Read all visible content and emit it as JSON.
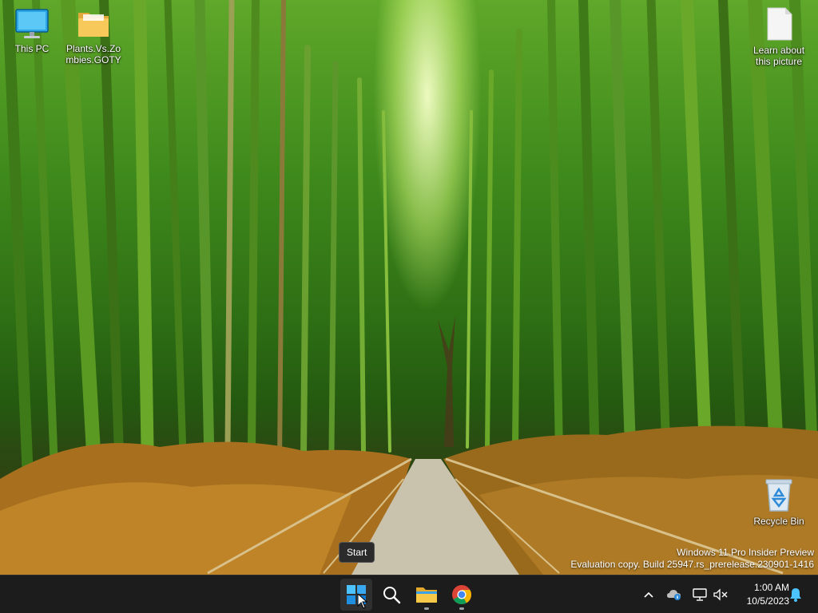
{
  "desktop": {
    "icons": [
      {
        "label": "This PC",
        "icon": "monitor-icon"
      },
      {
        "label": "Plants.Vs.Zombies.GOTY",
        "icon": "folder-icon"
      },
      {
        "label": "Learn about this picture",
        "icon": "file-icon"
      },
      {
        "label": "Recycle Bin",
        "icon": "recycle-bin-icon"
      }
    ]
  },
  "watermark": {
    "line1": "Windows 11 Pro Insider Preview",
    "line2": "Evaluation copy. Build 25947.rs_prerelease.230901-1416"
  },
  "tooltip": {
    "text": "Start"
  },
  "taskbar": {
    "apps": [
      {
        "name": "Start",
        "icon": "windows-start-icon"
      },
      {
        "name": "Search",
        "icon": "search-icon"
      },
      {
        "name": "File Explorer",
        "icon": "file-explorer-icon"
      },
      {
        "name": "Google Chrome",
        "icon": "chrome-icon"
      }
    ],
    "tray": {
      "icons": [
        "chevron-up-icon",
        "onedrive-icon",
        "network-icon",
        "volume-muted-icon",
        "notification-bell-icon"
      ]
    },
    "clock": {
      "time": "1:00 AM",
      "date": "10/5/2023"
    }
  },
  "colors": {
    "taskbar_bg": "#1c1c1c",
    "windows_blue": "#0078d4",
    "folder_yellow": "#f2c14e"
  }
}
